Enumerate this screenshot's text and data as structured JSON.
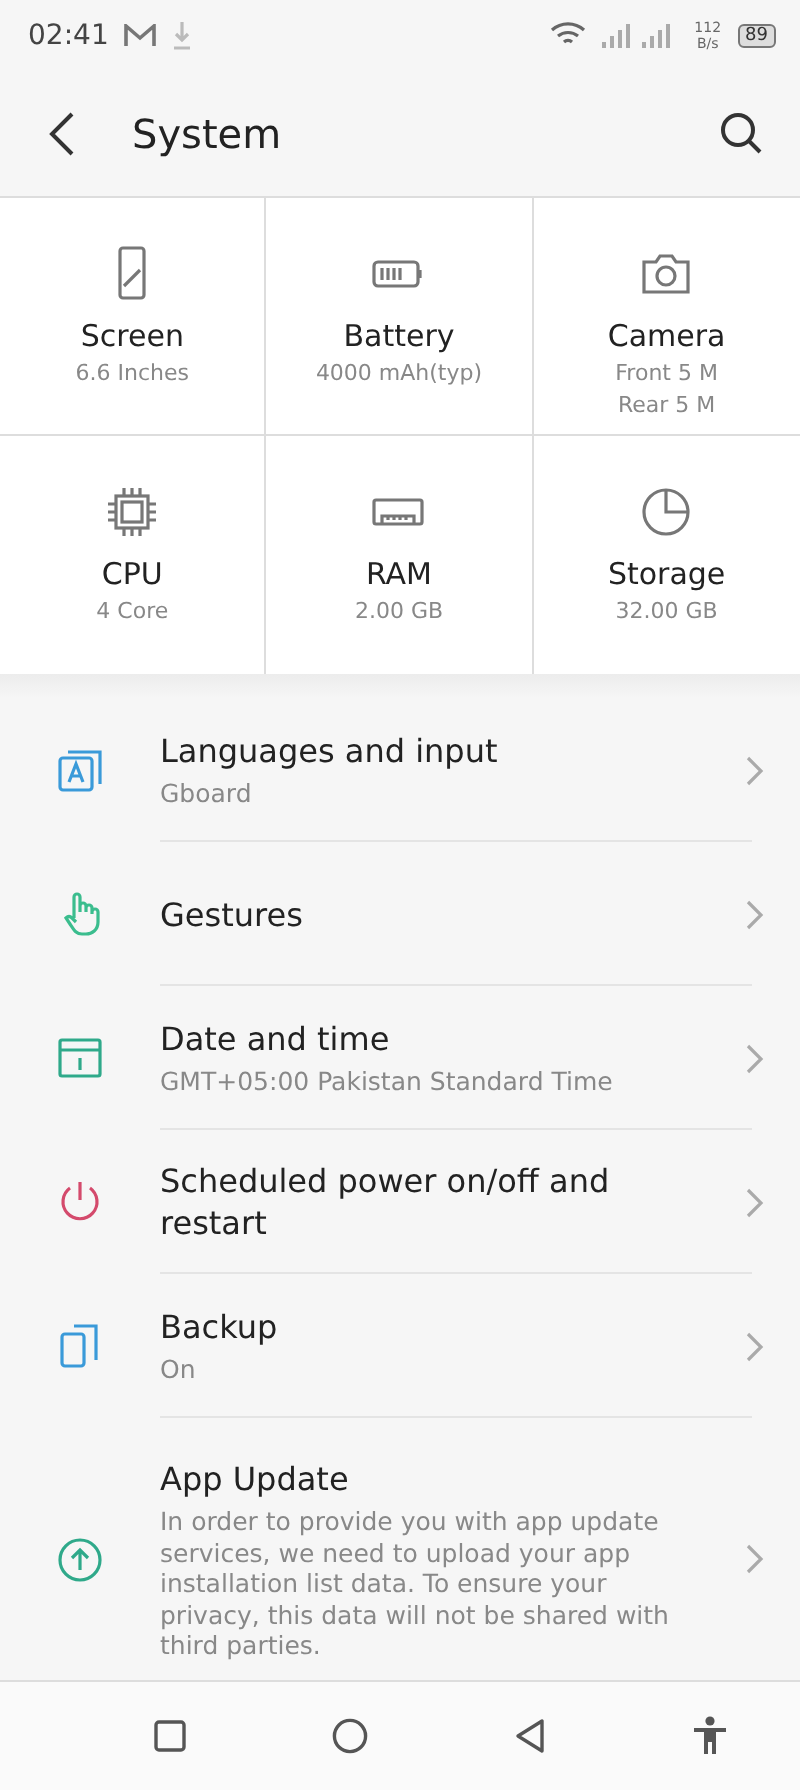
{
  "status_bar": {
    "time": "02:41",
    "speed_value": "112",
    "speed_unit": "B/s",
    "battery": "89"
  },
  "header": {
    "title": "System"
  },
  "specs": [
    {
      "label": "Screen",
      "values": [
        "6.6 Inches"
      ]
    },
    {
      "label": "Battery",
      "values": [
        "4000 mAh(typ)"
      ]
    },
    {
      "label": "Camera",
      "values": [
        "Front 5 M",
        "Rear 5 M"
      ]
    },
    {
      "label": "CPU",
      "values": [
        "4 Core"
      ]
    },
    {
      "label": "RAM",
      "values": [
        "2.00 GB"
      ]
    },
    {
      "label": "Storage",
      "values": [
        "32.00 GB"
      ]
    }
  ],
  "settings": [
    {
      "title": "Languages and input",
      "subtitle": "Gboard"
    },
    {
      "title": "Gestures"
    },
    {
      "title": "Date and time",
      "subtitle": "GMT+05:00 Pakistan Standard Time"
    },
    {
      "title": "Scheduled power on/off and restart"
    },
    {
      "title": "Backup",
      "subtitle": "On"
    },
    {
      "title": "App Update",
      "subtitle": "In order to provide you with app update services, we need to upload your app installation list data. To ensure your privacy, this data will not be shared with third parties."
    }
  ]
}
